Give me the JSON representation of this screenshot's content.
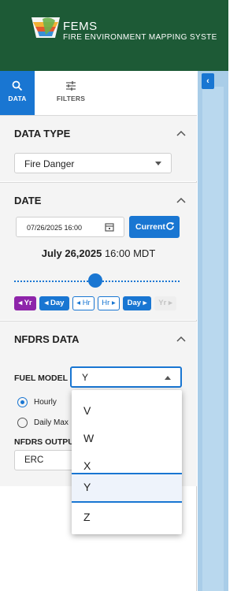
{
  "header": {
    "logo_text": "FEMS",
    "app_name": "FEMS",
    "app_subtitle": "FIRE ENVIRONMENT MAPPING SYSTE"
  },
  "tabs": [
    {
      "label": "DATA",
      "icon": "search-icon",
      "active": true
    },
    {
      "label": "FILTERS",
      "icon": "sliders-icon",
      "active": false
    }
  ],
  "data_type": {
    "title": "DATA TYPE",
    "selected": "Fire Danger"
  },
  "date": {
    "title": "DATE",
    "input_value": "07/26/2025 16:00",
    "current_label": "Current",
    "display_date_bold": "July 26,2025",
    "display_time": " 16:00 MDT",
    "slider_position": 0.5,
    "steps": {
      "yr_back": "◂ Yr",
      "day_back": "◂ Day",
      "hr_back": "◂ Hr",
      "hr_fwd": "Hr ▸",
      "day_fwd": "Day ▸",
      "yr_fwd": "Yr ▸"
    }
  },
  "nfdrs": {
    "title": "NFDRS DATA",
    "fuel_model_label": "FUEL MODEL",
    "fuel_model_value": "Y",
    "hourly_label": "Hourly",
    "daily_max_label": "Daily Max",
    "output_label": "NFDRS OUTPUT",
    "output_value": "ERC"
  },
  "fuel_model_options": [
    "V",
    "W",
    "X",
    "Y",
    "Z"
  ],
  "fuel_model_selected_option": "Y",
  "colors": {
    "header_bg": "#1d5a36",
    "accent": "#1976d2",
    "purple": "#8e24aa",
    "map_water": "#a9cde8"
  }
}
